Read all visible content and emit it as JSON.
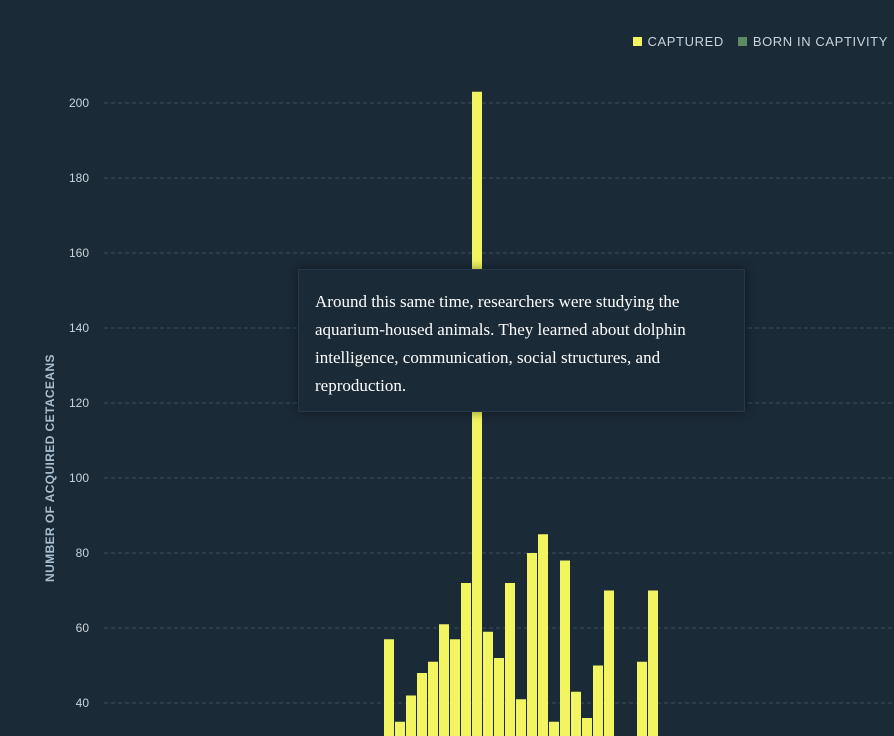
{
  "legend": {
    "captured_label": "CAPTURED",
    "born_label": "BORN IN CAPTIVITY",
    "captured_color": "#f2f55f",
    "born_color": "#5e8b64"
  },
  "tooltip": {
    "text": "Around this same time, researchers were studying the aquarium-housed animals. They learned about dolphin intelligence, communication, social structures, and reproduction."
  },
  "chart_data": {
    "type": "bar",
    "ylabel": "NUMBER OF ACQUIRED CETACEANS",
    "xlabel": "",
    "ylim": [
      30,
      210
    ],
    "yticks": [
      40,
      60,
      80,
      100,
      120,
      140,
      160,
      180,
      200
    ],
    "grid": true,
    "legend_position": "top-right",
    "series": [
      {
        "name": "CAPTURED",
        "color": "#f2f55f",
        "values": [
          57,
          35,
          42,
          48,
          51,
          61,
          57,
          72,
          203,
          59,
          52,
          72,
          41,
          80,
          85,
          35,
          78,
          43,
          36,
          50,
          70,
          0,
          0,
          51,
          70
        ]
      },
      {
        "name": "BORN IN CAPTIVITY",
        "color": "#5e8b64",
        "values": [
          0,
          0,
          0,
          0,
          0,
          0,
          0,
          0,
          0,
          0,
          0,
          0,
          0,
          0,
          0,
          0,
          0,
          0,
          0,
          0,
          0,
          0,
          0,
          0,
          0
        ]
      }
    ]
  }
}
